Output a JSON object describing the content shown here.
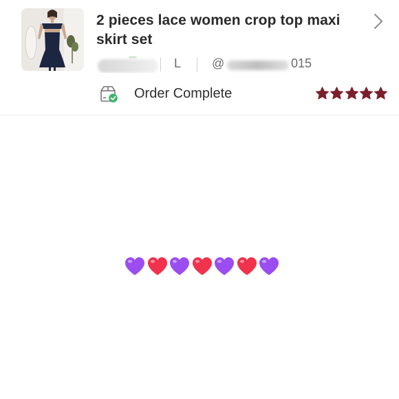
{
  "listing": {
    "title": "2 pieces lace women crop top maxi skirt set",
    "size": "L",
    "handle_prefix": "@",
    "handle_suffix": "015",
    "thumbnail_icon": "product-photo"
  },
  "order": {
    "status": "Order Complete",
    "status_icon": "package-check-icon",
    "rating": 5,
    "rating_max": 5,
    "star_color": "#7a1f2b"
  },
  "message": {
    "hearts": [
      "purple",
      "red",
      "purple",
      "red",
      "purple",
      "red",
      "purple"
    ],
    "colors": {
      "purple": "#9b4df0",
      "red": "#f0324d"
    }
  }
}
